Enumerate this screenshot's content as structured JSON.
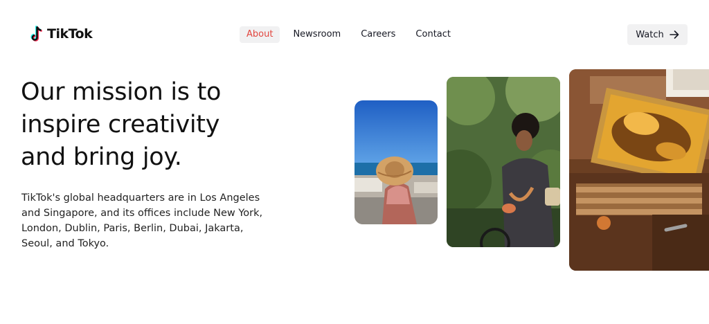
{
  "brand": {
    "name": "TikTok",
    "logo_icon": "tiktok-note-icon"
  },
  "nav": {
    "items": [
      {
        "label": "About",
        "active": true
      },
      {
        "label": "Newsroom",
        "active": false
      },
      {
        "label": "Careers",
        "active": false
      },
      {
        "label": "Contact",
        "active": false
      }
    ],
    "active_color": "#e2463f"
  },
  "watch_button": {
    "label": "Watch",
    "icon": "arrow-right-icon"
  },
  "hero": {
    "headline_lines": [
      "Our mission is to",
      "inspire creativity",
      "and bring joy."
    ],
    "body": "TikTok's global headquarters are in Los Angeles and Singapore, and its offices include New York, London, Dublin, Paris, Berlin, Dubai, Jakarta, Seoul, and Tokyo."
  },
  "photos": [
    {
      "name": "woman-sun-hat-seaside-photo"
    },
    {
      "name": "woman-cycling-photo"
    },
    {
      "name": "beekeeper-honeycomb-photo"
    }
  ]
}
